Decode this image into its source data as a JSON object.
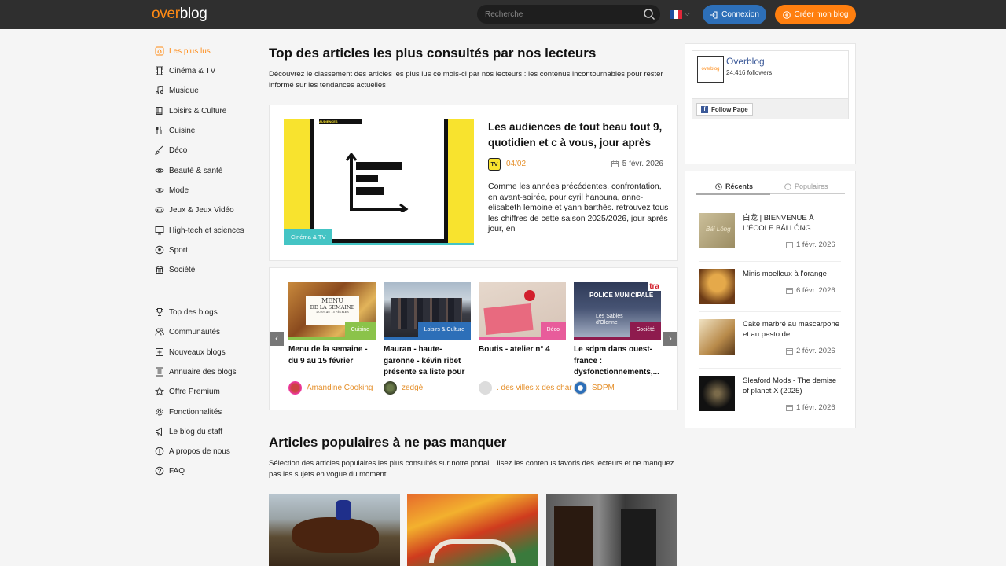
{
  "header": {
    "logo_part1": "over",
    "logo_part2": "blog",
    "search_placeholder": "Recherche",
    "login_label": "Connexion",
    "create_label": "Créer mon blog",
    "colors": {
      "bar": "#2f2f2f",
      "login": "#2d6fb8",
      "create": "#ff7f0f",
      "accent": "#ff8a14"
    }
  },
  "sidebar": {
    "categories": [
      {
        "label": "Les plus lus",
        "icon": "fire-icon",
        "active": true
      },
      {
        "label": "Cinéma & TV",
        "icon": "film-icon"
      },
      {
        "label": "Musique",
        "icon": "music-icon"
      },
      {
        "label": "Loisirs & Culture",
        "icon": "book-icon"
      },
      {
        "label": "Cuisine",
        "icon": "utensils-icon"
      },
      {
        "label": "Déco",
        "icon": "brush-icon"
      },
      {
        "label": "Beauté & santé",
        "icon": "eye-icon"
      },
      {
        "label": "Mode",
        "icon": "eye-icon"
      },
      {
        "label": "Jeux & Jeux Vidéo",
        "icon": "gamepad-icon"
      },
      {
        "label": "High-tech et sciences",
        "icon": "monitor-icon"
      },
      {
        "label": "Sport",
        "icon": "ball-icon"
      },
      {
        "label": "Société",
        "icon": "building-icon"
      }
    ],
    "links": [
      {
        "label": "Top des blogs",
        "icon": "trophy-icon"
      },
      {
        "label": "Communautés",
        "icon": "users-icon"
      },
      {
        "label": "Nouveaux blogs",
        "icon": "plus-square-icon"
      },
      {
        "label": "Annuaire des blogs",
        "icon": "list-icon"
      },
      {
        "label": "Offre Premium",
        "icon": "star-icon"
      },
      {
        "label": "Fonctionnalités",
        "icon": "gear-icon"
      },
      {
        "label": "Le blog du staff",
        "icon": "megaphone-icon"
      },
      {
        "label": "A propos de nous",
        "icon": "info-icon"
      },
      {
        "label": "FAQ",
        "icon": "question-icon"
      }
    ]
  },
  "top": {
    "title": "Top des articles les plus consultés par nos lecteurs",
    "description": "Découvrez le classement des articles les plus lus ce mois-ci par nos lecteurs : les contenus incontournables pour rester informé sur les tendances actuelles",
    "featured": {
      "image_banner": "AUDIENCES",
      "category": "Cinéma & TV",
      "category_color": "#44c4c4",
      "title": "Les audiences de tout beau tout 9, quotidien et c à vous, jour après",
      "cat_icon_text": "TV",
      "date_code": "04/02",
      "date": "5 févr. 2026",
      "excerpt": "Comme les années précédentes, confrontation, en avant-soirée, pour cyril hanouna, anne-elisabeth lemoine et yann barthès. retrouvez tous les chiffres de cette saison 2025/2026, jour après jour, en"
    },
    "carousel": [
      {
        "title": "Menu de la semaine - du 9 au 15 février",
        "category": "Cuisine",
        "color": "#8bc34a",
        "author": "Amandine Cooking",
        "img_line1": "MENU",
        "img_line2": "DE LA SEMAINE",
        "img_line3": "DU 09 AU 15 FÉVRIER"
      },
      {
        "title": "Mauran - haute-garonne - kévin ribet présente sa liste pour",
        "category": "Loisirs & Culture",
        "color": "#2d6fb8",
        "author": "zedgé"
      },
      {
        "title": "Boutis - atelier n° 4",
        "category": "Déco",
        "color": "#e85c9b",
        "author": ". des villes x des char"
      },
      {
        "title": "Le sdpm dans ouest-france : dysfonctionnements,...",
        "category": "Société",
        "color": "#8e1b4e",
        "author": "SDPM",
        "img_text": "POLICE MUNICIPALE",
        "img_badge": "tra",
        "img_town": "Les Sables d'Olonne"
      }
    ]
  },
  "popular": {
    "title": "Articles populaires à ne pas manquer",
    "description": "Sélection des articles populaires les plus consultés sur notre portail : lisez les contenus favoris des lecteurs et ne manquez pas les sujets en vogue du moment"
  },
  "facebook": {
    "name": "Overblog",
    "followers": "24,416 followers",
    "follow_label": "Follow Page",
    "logo_text": "overblog"
  },
  "recent": {
    "tab_recent": "Récents",
    "tab_popular": "Populaires",
    "items": [
      {
        "title": "白龙 | BIENVENUE À L'ÉCOLE BÁI LÓNG",
        "date": "1 févr. 2026",
        "thumb_text": "Bái Lóng"
      },
      {
        "title": "Minis moelleux à l'orange",
        "date": "6 févr. 2026"
      },
      {
        "title": "Cake marbré au mascarpone et au pesto de",
        "date": "2 févr. 2026"
      },
      {
        "title": "Sleaford Mods - The demise of planet X (2025)",
        "date": "1 févr. 2026"
      }
    ]
  }
}
